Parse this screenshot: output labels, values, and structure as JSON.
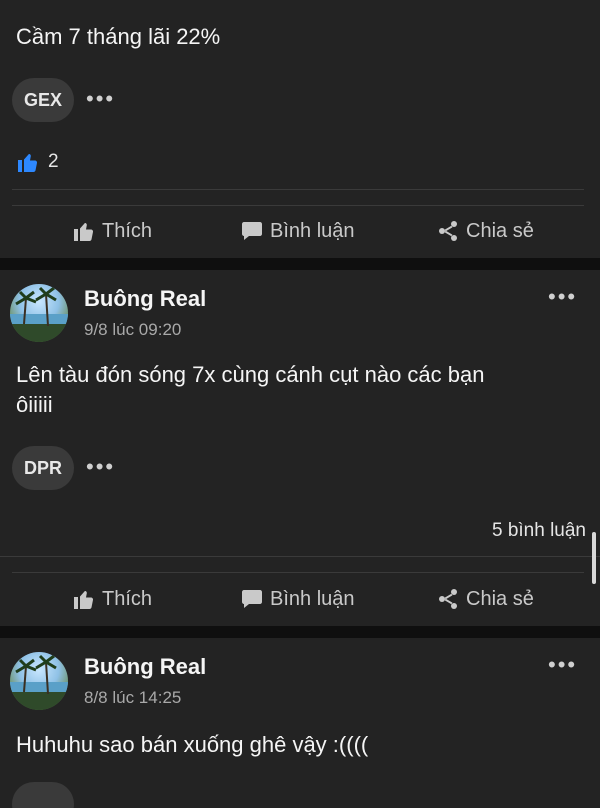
{
  "posts": [
    {
      "text": "Cầm 7 tháng lãi 22%",
      "tag": "GEX",
      "like_count": "2",
      "actions": {
        "like": "Thích",
        "comment": "Bình luận",
        "share": "Chia sẻ"
      }
    },
    {
      "author": "Buông Real",
      "time": "9/8 lúc 09:20",
      "text_line1": "Lên tàu đón sóng 7x cùng cánh cụt nào các bạn",
      "text_line2": "ôiiiii",
      "tag": "DPR",
      "comments": "5 bình luận",
      "actions": {
        "like": "Thích",
        "comment": "Bình luận",
        "share": "Chia sẻ"
      }
    },
    {
      "author": "Buông Real",
      "time": "8/8 lúc 14:25",
      "text": "Huhuhu sao bán xuống ghê vậy :(((("
    }
  ],
  "icons": {
    "more": "more-dots-icon",
    "like": "thumbs-up-icon",
    "comment": "comment-bubble-icon",
    "share": "share-icon",
    "reaction": "like-reaction-icon"
  },
  "colors": {
    "background": "#0f0f0f",
    "card": "#232323",
    "reaction_blue": "#2d88ff"
  }
}
